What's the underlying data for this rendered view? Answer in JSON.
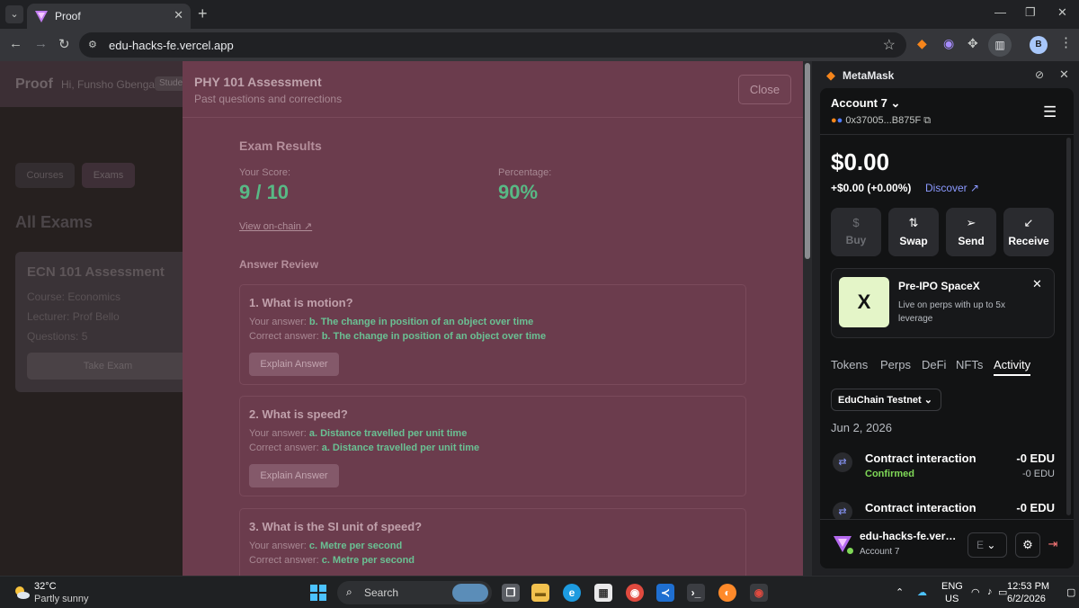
{
  "browser": {
    "tab_title": "Proof",
    "url": "edu-hacks-fe.vercel.app",
    "profile_initial": "B",
    "new_tab_label": "+",
    "window_minimize": "—",
    "window_maximize": "❐",
    "window_close": "✕"
  },
  "app": {
    "logo": "Proof",
    "greeting": "Hi, Funsho Gbenga",
    "role_badge": "Student",
    "nav": {
      "courses": "Courses",
      "exams": "Exams"
    },
    "heading": "All Exams",
    "exam_card": {
      "title": "ECN 101 Assessment",
      "course": "Course: Economics",
      "lecturer": "Lecturer: Prof Bello",
      "questions": "Questions: 5",
      "button": "Take Exam"
    }
  },
  "modal": {
    "title": "PHY 101 Assessment",
    "subtitle": "Past questions and corrections",
    "close_label": "Close",
    "results_title": "Exam Results",
    "score_label": "Your Score:",
    "score_value": "9 / 10",
    "percentage_label": "Percentage:",
    "percentage_value": "90%",
    "onchain_link": "View on-chain ↗",
    "review_title": "Answer Review",
    "your_answer_label": "Your answer:",
    "correct_answer_label": "Correct answer:",
    "explain_label": "Explain Answer",
    "questions": [
      {
        "question": "1. What is motion?",
        "your_answer": "b. The change in position of an object over time",
        "correct_answer": "b. The change in position of an object over time"
      },
      {
        "question": "2. What is speed?",
        "your_answer": "a. Distance travelled per unit time",
        "correct_answer": "a. Distance travelled per unit time"
      },
      {
        "question": "3. What is the SI unit of speed?",
        "your_answer": "c. Metre per second",
        "correct_answer": "c. Metre per second"
      }
    ]
  },
  "metamask": {
    "panel_title": "MetaMask",
    "account_name": "Account 7",
    "address": "0x37005...B875F",
    "balance": "$0.00",
    "change": "+$0.00 (+0.00%)",
    "discover_label": "Discover",
    "actions": [
      {
        "label": "Buy",
        "icon": "$"
      },
      {
        "label": "Swap",
        "icon": "⇅"
      },
      {
        "label": "Send",
        "icon": "➢"
      },
      {
        "label": "Receive",
        "icon": "↙"
      }
    ],
    "promo": {
      "title": "Pre-IPO SpaceX",
      "description": "Live on perps with up to 5x leverage",
      "logo_text": "X"
    },
    "tabs": [
      "Tokens",
      "Perps",
      "DeFi",
      "NFTs",
      "Activity"
    ],
    "active_tab": "Activity",
    "network": "EduChain Testnet",
    "date": "Jun 2, 2026",
    "transactions": [
      {
        "title": "Contract interaction",
        "status": "Confirmed",
        "amount": "-0 EDU",
        "sub_amount": "-0 EDU"
      },
      {
        "title": "Contract interaction",
        "status": "",
        "amount": "-0 EDU",
        "sub_amount": ""
      }
    ],
    "footer": {
      "site_name": "edu-hacks-fe.vercel.app",
      "site_account": "Account 7",
      "select_value": "E"
    },
    "status_color": "#7fd857",
    "accent_color": "#8b99ff"
  },
  "taskbar": {
    "weather_temp": "32°C",
    "weather_desc": "Partly sunny",
    "search_placeholder": "Search",
    "language": "ENG",
    "region": "US",
    "time": "12:53 PM",
    "date": "6/2/2026"
  },
  "colors": {
    "modal_bg": "#6b3c4d",
    "success_green": "#58b985",
    "metamask_orange": "#f6851b"
  }
}
